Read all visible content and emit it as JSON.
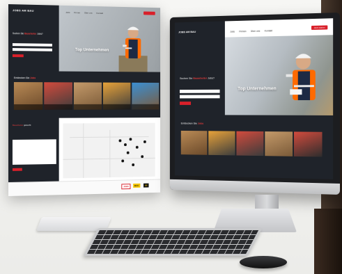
{
  "brand": {
    "logo": "JOBS AM BAU"
  },
  "nav": {
    "items": [
      "Jobs",
      "Firmen",
      "Über uns",
      "Kontakt"
    ],
    "cta": "Jetzt starten"
  },
  "search": {
    "title_pre": "Suchen Sie ",
    "title_accent": "Bauarbeiter",
    "title_post": " Jobs?",
    "field1_placeholder": "Jobtitel",
    "field2_placeholder": "Ort"
  },
  "hero": {
    "headline": "Top Unternehmen"
  },
  "section": {
    "title_pre": "Entdecken Sie ",
    "title_accent": "Jobs"
  },
  "lower": {
    "title_accent": "Bauarbeiter",
    "title_white": " gesucht"
  },
  "footer": {
    "logos": [
      "JOBS",
      "BAU",
      "DE"
    ]
  },
  "colors": {
    "accent": "#d9202a",
    "sidebar": "#1f232a"
  }
}
